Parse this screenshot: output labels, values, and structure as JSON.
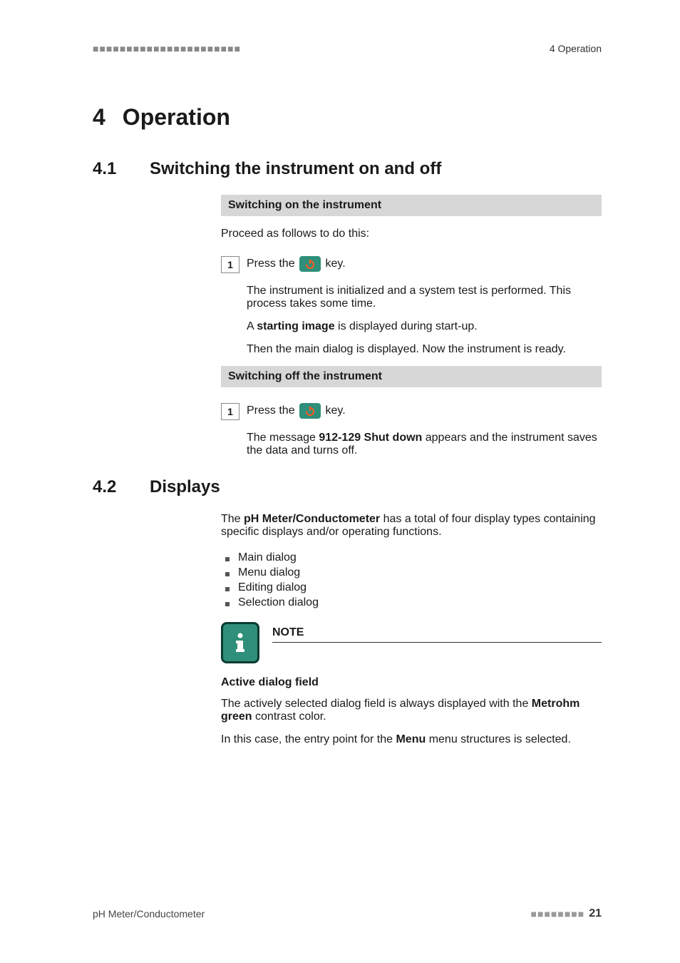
{
  "header": {
    "dashes_left": "■■■■■■■■■■■■■■■■■■■■■■",
    "running_title": "4 Operation"
  },
  "chapter": {
    "number": "4",
    "title": "Operation"
  },
  "sections": {
    "s41": {
      "number": "4.1",
      "title": "Switching the instrument on and off",
      "task_on": {
        "banner": "Switching on the instrument",
        "intro": "Proceed as follows to do this:",
        "step1_num": "1",
        "step1_pre": "Press the ",
        "step1_post": " key.",
        "result_p1": "The instrument is initialized and a system test is performed. This process takes some time.",
        "result_p2_pre": "A ",
        "result_p2_bold": "starting image",
        "result_p2_post": " is displayed during start-up.",
        "result_p3": "Then the main dialog is displayed. Now the instrument is ready."
      },
      "task_off": {
        "banner": "Switching off the instrument",
        "step1_num": "1",
        "step1_pre": "Press the ",
        "step1_post": " key.",
        "result_p1_pre": "The message ",
        "result_p1_bold": "912-129 Shut down",
        "result_p1_post": " appears and the instrument saves the data and turns off."
      }
    },
    "s42": {
      "number": "4.2",
      "title": "Displays",
      "intro_pre": "The ",
      "intro_bold": "pH Meter/Conductometer",
      "intro_post": " has a total of four display types containing specific displays and/or operating functions.",
      "bullets": [
        "Main dialog",
        "Menu dialog",
        "Editing dialog",
        "Selection dialog"
      ],
      "note": {
        "title": "NOTE",
        "subhead": "Active dialog field",
        "p1_pre": "The actively selected dialog field is always displayed with the ",
        "p1_bold": "Metrohm green",
        "p1_post": " contrast color.",
        "p2_pre": "In this case, the entry point for the ",
        "p2_bold": "Menu",
        "p2_post": " menu structures is selected."
      }
    }
  },
  "footer": {
    "left": "pH Meter/Conductometer",
    "dashes_right": "■■■■■■■■",
    "page": "21"
  },
  "colors": {
    "accent_green": "#2f8f7a",
    "icon_border": "#0a3b31",
    "power_symbol": "#ff5a1f"
  }
}
